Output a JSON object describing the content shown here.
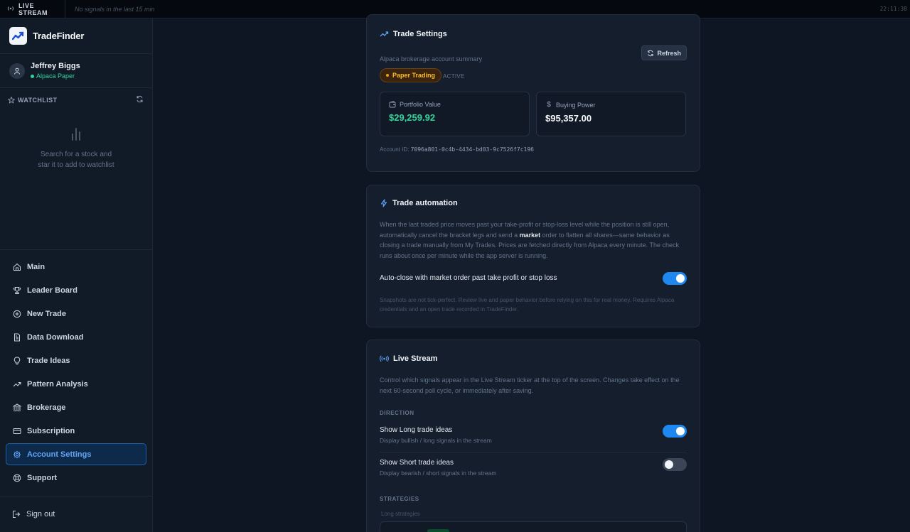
{
  "ticker": {
    "label": "LIVE STREAM",
    "status": "No signals in the last 15 min",
    "clock": "22:11:38"
  },
  "brand": {
    "name": "TradeFinder"
  },
  "user": {
    "name": "Jeffrey Biggs",
    "account": "Alpaca Paper"
  },
  "watchlist": {
    "title": "WATCHLIST",
    "empty_line1": "Search for a stock and",
    "empty_line2": "star it to add to watchlist"
  },
  "nav": {
    "items": [
      {
        "label": "Main",
        "icon": "home-icon"
      },
      {
        "label": "Leader Board",
        "icon": "trophy-icon"
      },
      {
        "label": "New Trade",
        "icon": "plus-circle-icon"
      },
      {
        "label": "Data Download",
        "icon": "file-icon"
      },
      {
        "label": "Trade Ideas",
        "icon": "lightbulb-icon"
      },
      {
        "label": "Pattern Analysis",
        "icon": "trend-icon"
      },
      {
        "label": "Brokerage",
        "icon": "bank-icon"
      },
      {
        "label": "Subscription",
        "icon": "card-icon"
      },
      {
        "label": "Account Settings",
        "icon": "gear-icon",
        "active": true
      },
      {
        "label": "Support",
        "icon": "lifebuoy-icon"
      }
    ],
    "signout": "Sign out"
  },
  "trade_settings": {
    "title": "Trade Settings",
    "subtitle": "Alpaca brokerage account summary",
    "refresh": "Refresh",
    "badge": "Paper Trading",
    "status": "ACTIVE",
    "portfolio_label": "Portfolio Value",
    "portfolio_value": "$29,259.92",
    "buying_label": "Buying Power",
    "buying_value": "$95,357.00",
    "account_id_label": "Account ID:",
    "account_id": "7096a801-0c4b-4434-bd03-9c7526f7c196"
  },
  "automation": {
    "title": "Trade automation",
    "desc_1": "When the last traded price moves past your take-profit or stop-loss level while the position is still open, automatically cancel the bracket legs and send a ",
    "desc_bold": "market",
    "desc_2": " order to flatten all shares—same behavior as closing a trade manually from My Trades. Prices are fetched directly from Alpaca every minute. The check runs about once per minute while the app server is running.",
    "toggle_label": "Auto-close with market order past take profit or stop loss",
    "toggle_on": true,
    "note": "Snapshots are not tick-perfect. Review live and paper behavior before relying on this for real money. Requires Alpaca credentials and an open trade recorded in TradeFinder."
  },
  "live_stream": {
    "title": "Live Stream",
    "desc": "Control which signals appear in the Live Stream ticker at the top of the screen. Changes take effect on the next 60-second poll cycle, or immediately after saving.",
    "direction_label": "DIRECTION",
    "long_title": "Show Long trade ideas",
    "long_sub": "Display bullish / long signals in the stream",
    "long_on": true,
    "short_title": "Show Short trade ideas",
    "short_sub": "Display bearish / short signals in the stream",
    "short_on": false,
    "strategies_label": "STRATEGIES",
    "long_strategies": "Long strategies"
  },
  "colors": {
    "accent": "#1e88f0",
    "positive": "#34d399",
    "warning": "#fbbf24"
  }
}
